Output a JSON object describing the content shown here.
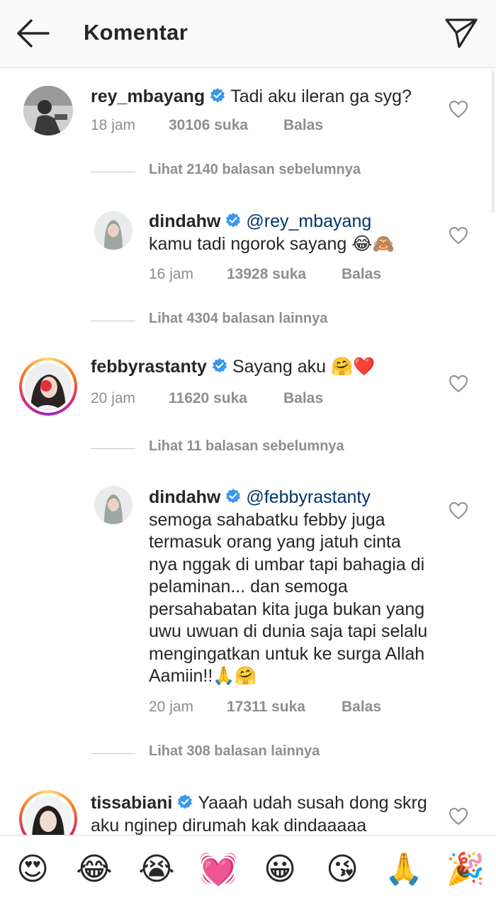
{
  "header": {
    "title": "Komentar"
  },
  "comments": [
    {
      "username": "rey_mbayang",
      "text": "Tadi aku ileran ga syg?",
      "time": "18 jam",
      "likes": "30106 suka",
      "reply": "Balas",
      "view_replies": "Lihat 2140 balasan sebelumnya"
    },
    {
      "username": "dindahw",
      "mention": "@rey_mbayang",
      "text": "kamu tadi ngorok sayang 😂🙈",
      "time": "16 jam",
      "likes": "13928 suka",
      "reply": "Balas",
      "view_replies": "Lihat 4304 balasan lainnya"
    },
    {
      "username": "febbyrastanty",
      "text": "Sayang aku 🤗❤️",
      "time": "20 jam",
      "likes": "11620 suka",
      "reply": "Balas",
      "view_replies": "Lihat 11 balasan sebelumnya"
    },
    {
      "username": "dindahw",
      "mention": "@febbyrastanty",
      "text": "semoga sahabatku febby juga termasuk orang yang jatuh cinta nya nggak di umbar tapi bahagia di pelaminan... dan semoga persahabatan kita juga bukan yang uwu uwuan di dunia saja tapi selalu mengingatkan untuk ke surga Allah Aamiin!!🙏🤗",
      "time": "20 jam",
      "likes": "17311 suka",
      "reply": "Balas",
      "view_replies": "Lihat 308 balasan lainnya"
    },
    {
      "username": "tissabiani",
      "text": "Yaaah udah susah dong skrg aku nginep dirumah kak dindaaaaa"
    }
  ],
  "emojis": [
    "😍",
    "😂",
    "😭",
    "💓",
    "😀",
    "😘",
    "🙏",
    "🎉"
  ],
  "colors": {
    "verified": "#3897f0",
    "mention": "#003569",
    "meta": "#8e8e8e",
    "story_ring": "#e1306c"
  }
}
